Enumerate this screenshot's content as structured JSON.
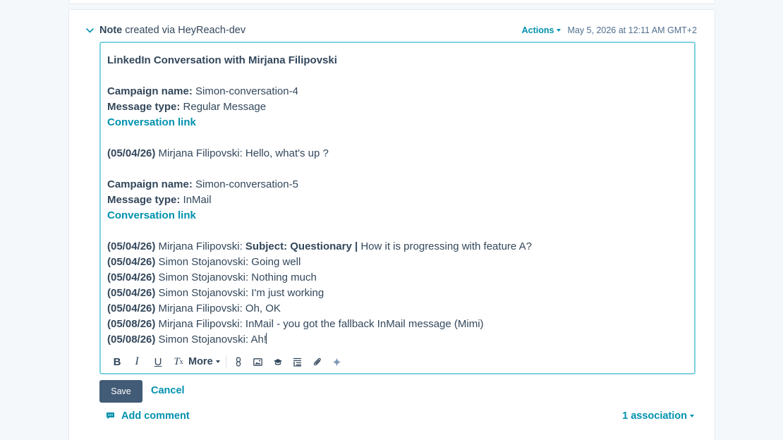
{
  "note": {
    "type_label": "Note",
    "created_via": " created via HeyReach-dev",
    "actions_label": "Actions",
    "timestamp": "May 5, 2026 at 12:11 AM GMT+2"
  },
  "body": {
    "heading": "LinkedIn Conversation with Mirjana Filipovski",
    "campaign_label": "Campaign name:",
    "message_type_label": "Message type:",
    "conversation_link": "Conversation link",
    "block1": {
      "campaign_name": " Simon-conversation-4",
      "message_type": " Regular Message",
      "messages": [
        {
          "date": "(05/04/26)",
          "text": " Mirjana Filipovski: Hello, what's up ?"
        }
      ]
    },
    "block2": {
      "campaign_name": " Simon-conversation-5",
      "message_type": " InMail",
      "first_message": {
        "date": "(05/04/26)",
        "sender": " Mirjana Filipovski: ",
        "subject": "Subject: Questionary |",
        "text": " How it is progressing with feature A?"
      },
      "messages": [
        {
          "date": "(05/04/26)",
          "text": " Simon Stojanovski: Going well"
        },
        {
          "date": "(05/04/26)",
          "text": " Simon Stojanovski: Nothing much"
        },
        {
          "date": "(05/04/26)",
          "text": " Simon Stojanovski: I'm just working"
        },
        {
          "date": "(05/04/26)",
          "text": " Mirjana Filipovski: Oh, OK"
        },
        {
          "date": "(05/08/26)",
          "text": " Mirjana Filipovski: InMail - you got the fallback InMail message (Mimi)"
        },
        {
          "date": "(05/08/26)",
          "text": " Simon Stojanovski: Ah!"
        }
      ]
    }
  },
  "toolbar": {
    "bold": "B",
    "italic": "I",
    "underline": "U",
    "clear_format": "T",
    "clear_format_sub": "x",
    "more_label": "More"
  },
  "footer": {
    "save_label": "Save",
    "cancel_label": "Cancel",
    "add_comment_label": "Add comment",
    "association_label": "1 association"
  },
  "colors": {
    "accent": "#0091ae",
    "text": "#33475b",
    "save_bg": "#425b76",
    "editor_border": "#7fd1de"
  }
}
